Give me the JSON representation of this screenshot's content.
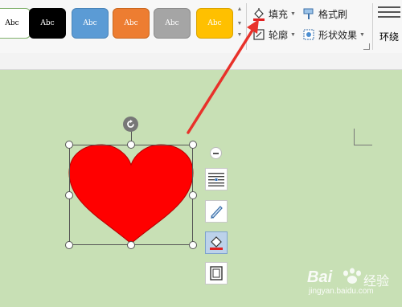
{
  "ribbon": {
    "style_swatches": [
      {
        "label": "Abc",
        "bg": "#ffffff",
        "fg": "#000000",
        "border": "#7fb06a"
      },
      {
        "label": "Abc",
        "bg": "#000000",
        "fg": "#ffffff",
        "border": "#000000"
      },
      {
        "label": "Abc",
        "bg": "#5b9bd5",
        "fg": "#ffffff",
        "border": "#4a84b8"
      },
      {
        "label": "Abc",
        "bg": "#ed7d31",
        "fg": "#ffffff",
        "border": "#c9671f"
      },
      {
        "label": "Abc",
        "bg": "#a5a5a5",
        "fg": "#ffffff",
        "border": "#8c8c8c"
      },
      {
        "label": "Abc",
        "bg": "#ffc000",
        "fg": "#ffffff",
        "border": "#d9a300"
      }
    ],
    "fill_label": "填充",
    "format_painter_label": "格式刷",
    "outline_label": "轮廓",
    "shape_effects_label": "形状效果",
    "wrap_label": "环绕"
  },
  "canvas": {
    "shape": "heart",
    "fill_color": "#ff0000",
    "outline_color": "#b30000"
  },
  "float_toolbar": {
    "buttons": [
      "minus-icon",
      "layout-options-icon",
      "pen-icon",
      "fill-bucket-icon",
      "frame-icon"
    ]
  },
  "annotation": {
    "arrow_color": "#e8312a"
  },
  "watermark": {
    "brand": "Bai",
    "brand_tail": "经验",
    "domain": "jingyan.baidu.com"
  }
}
